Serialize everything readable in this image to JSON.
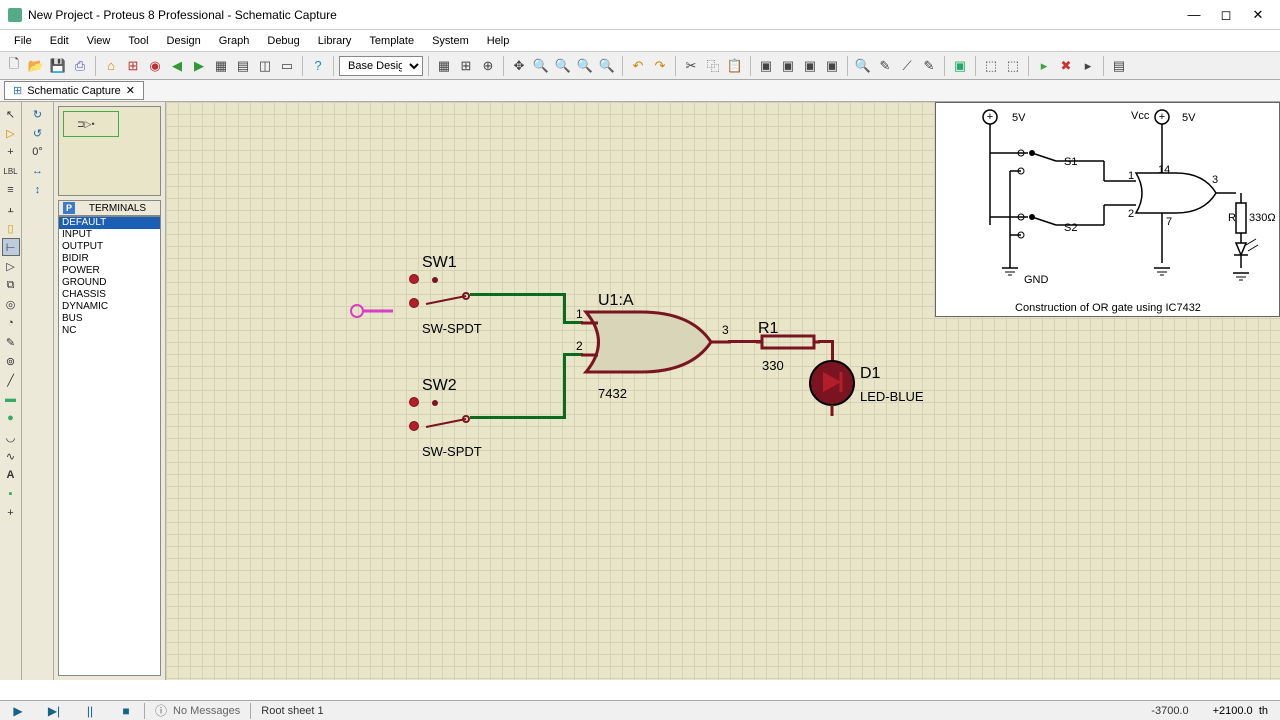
{
  "title": "New Project - Proteus 8 Professional - Schematic Capture",
  "menu": [
    "File",
    "Edit",
    "View",
    "Tool",
    "Design",
    "Graph",
    "Debug",
    "Library",
    "Template",
    "System",
    "Help"
  ],
  "combo": "Base Design",
  "tab": "Schematic Capture",
  "panel": {
    "header": "TERMINALS",
    "items": [
      "DEFAULT",
      "INPUT",
      "OUTPUT",
      "BIDIR",
      "POWER",
      "GROUND",
      "CHASSIS",
      "DYNAMIC",
      "BUS",
      "NC"
    ],
    "selected": 0
  },
  "sch": {
    "sw1": {
      "name": "SW1",
      "type": "SW-SPDT"
    },
    "sw2": {
      "name": "SW2",
      "type": "SW-SPDT"
    },
    "gate": {
      "name": "U1:A",
      "type": "7432",
      "p1": "1",
      "p2": "2",
      "p3": "3"
    },
    "r1": {
      "name": "R1",
      "value": "330"
    },
    "d1": {
      "name": "D1",
      "type": "LED-BLUE"
    }
  },
  "ref": {
    "v1": "5V",
    "v2": "5V",
    "vcc": "Vcc",
    "s1": "S1",
    "s2": "S2",
    "gnd": "GND",
    "p1": "1",
    "p2": "2",
    "p3": "3",
    "p14": "14",
    "p7": "7",
    "rl": "R",
    "rv": "330Ω",
    "cap": "Construction of OR gate using IC7432"
  },
  "status": {
    "msg": "No Messages",
    "sheet": "Root sheet 1",
    "x": "-3700.0",
    "y": "+2100.0",
    "unit": "th"
  },
  "rot": "0°"
}
